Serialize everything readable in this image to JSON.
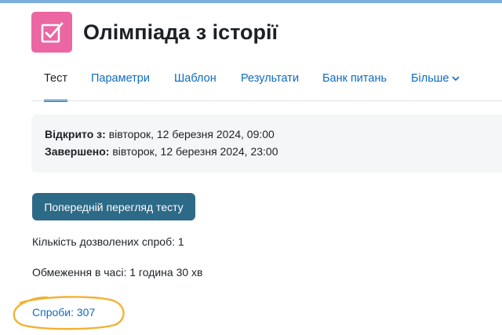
{
  "page": {
    "title": "Олімпіада з історії",
    "icon": "quiz-checkbox-icon",
    "icon_color": "#eb66a2"
  },
  "tabs": [
    {
      "label": "Тест",
      "active": true
    },
    {
      "label": "Параметри",
      "active": false
    },
    {
      "label": "Шаблон",
      "active": false
    },
    {
      "label": "Результати",
      "active": false
    },
    {
      "label": "Банк питань",
      "active": false
    },
    {
      "label": "Більше",
      "active": false,
      "icon": "chevron-down-icon"
    }
  ],
  "dates": {
    "opened_label": "Відкрито з:",
    "opened_value": "вівторок, 12 березня 2024, 09:00",
    "closed_label": "Завершено:",
    "closed_value": "вівторок, 12 березня 2024, 23:00"
  },
  "preview_button": "Попередній перегляд тесту",
  "info": {
    "attempts_allowed": "Кількість дозволених спроб: 1",
    "time_limit": "Обмеження в часі: 1 година 30 хв"
  },
  "attempts_link": "Спроби: 307",
  "colors": {
    "accent": "#0f6cbf",
    "button": "#2d6a87",
    "highlight_marker": "#f2b233"
  }
}
